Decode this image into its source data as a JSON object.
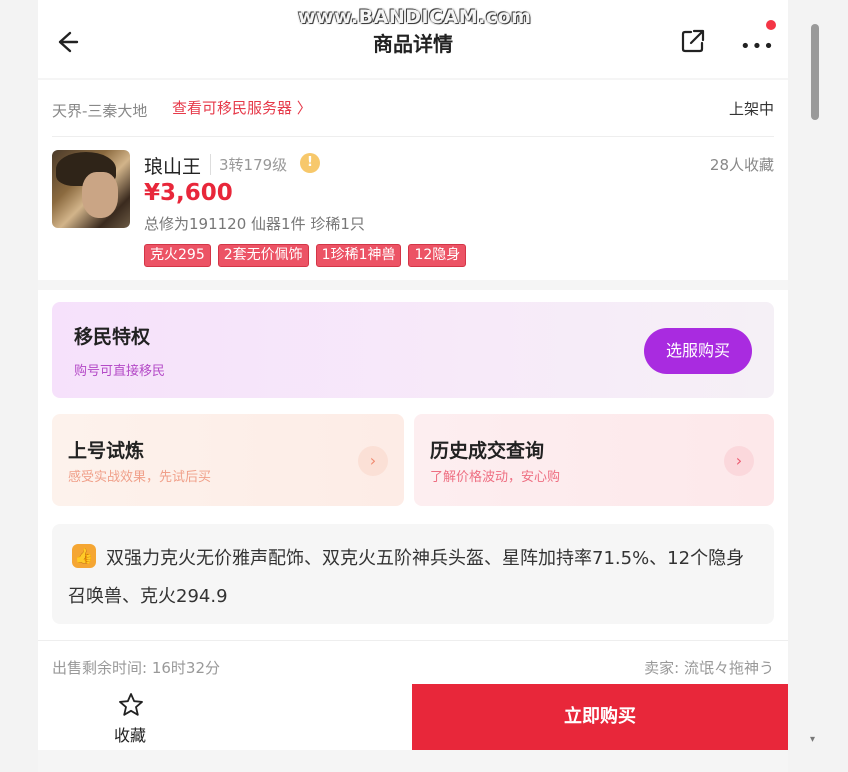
{
  "watermark": "www.BANDICAM.com",
  "header": {
    "title": "商品详情",
    "more": "•••"
  },
  "product": {
    "server": "天界-三秦大地",
    "server_link": "查看可移民服务器 〉",
    "status": "上架中",
    "role_name": "琅山王",
    "role_level": "3转179级",
    "info_mark": "!",
    "favorites": "28人收藏",
    "price": "¥3,600",
    "stats": "总修为191120  仙器1件  珍稀1只",
    "tags": [
      "克火295",
      "2套无价佩饰",
      "1珍稀1神兽",
      "12隐身"
    ]
  },
  "migrate": {
    "title": "移民特权",
    "subtitle": "购号可直接移民",
    "button": "选服购买"
  },
  "tiles": [
    {
      "title": "上号试炼",
      "subtitle": "感受实战效果，先试后买",
      "arrow": "›"
    },
    {
      "title": "历史成交查询",
      "subtitle": "了解价格波动，安心购",
      "arrow": "›"
    }
  ],
  "description": {
    "icon": "👍",
    "text": "双强力克火无价雅声配饰、双克火五阶神兵头盔、星阵加持率71.5%、12个隐身召唤兽、克火294.9"
  },
  "footer": {
    "time_left": "出售剩余时间: 16时32分",
    "seller": "卖家: 流氓々拖神う"
  },
  "bottom": {
    "collect_label": "收藏",
    "buy_label": "立即购买"
  },
  "colors": {
    "accent_red": "#e8273a",
    "purple": "#a92be0",
    "tag_red": "#ec5365"
  }
}
